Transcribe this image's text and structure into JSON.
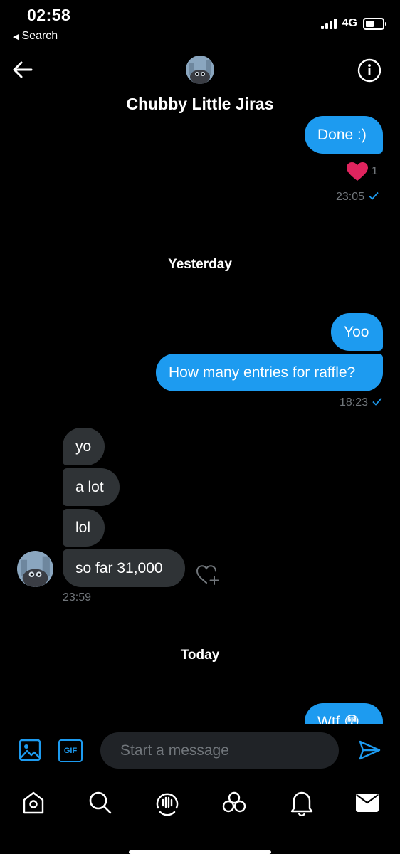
{
  "status_bar": {
    "time": "02:58",
    "back_label": "Search",
    "network": "4G"
  },
  "header": {
    "title": "Chubby Little Jiras"
  },
  "messages": {
    "done": {
      "text": "Done :)",
      "reaction_count": "1",
      "time": "23:05"
    },
    "yesterday_label": "Yesterday",
    "yoo": {
      "text": "Yoo"
    },
    "raffle": {
      "text": "How many entries for raffle?",
      "time": "18:23"
    },
    "received": [
      {
        "text": "yo"
      },
      {
        "text": "a lot"
      },
      {
        "text": "lol"
      },
      {
        "text": "so far 31,000"
      }
    ],
    "received_time": "23:59",
    "today_label": "Today",
    "wtf": {
      "text": "Wtf 😳"
    }
  },
  "composer": {
    "placeholder": "Start a message",
    "gif_label": "GIF"
  },
  "icons": {
    "image": "image-icon",
    "gif": "gif-icon",
    "send": "send-icon",
    "home": "home-icon",
    "search": "search-icon",
    "spaces": "spaces-icon",
    "communities": "communities-icon",
    "notifications": "bell-icon",
    "messages": "mail-icon"
  },
  "colors": {
    "accent": "#1d9bf0",
    "received_bubble": "#2f3336",
    "heart": "#f91880",
    "muted": "#71767b"
  }
}
